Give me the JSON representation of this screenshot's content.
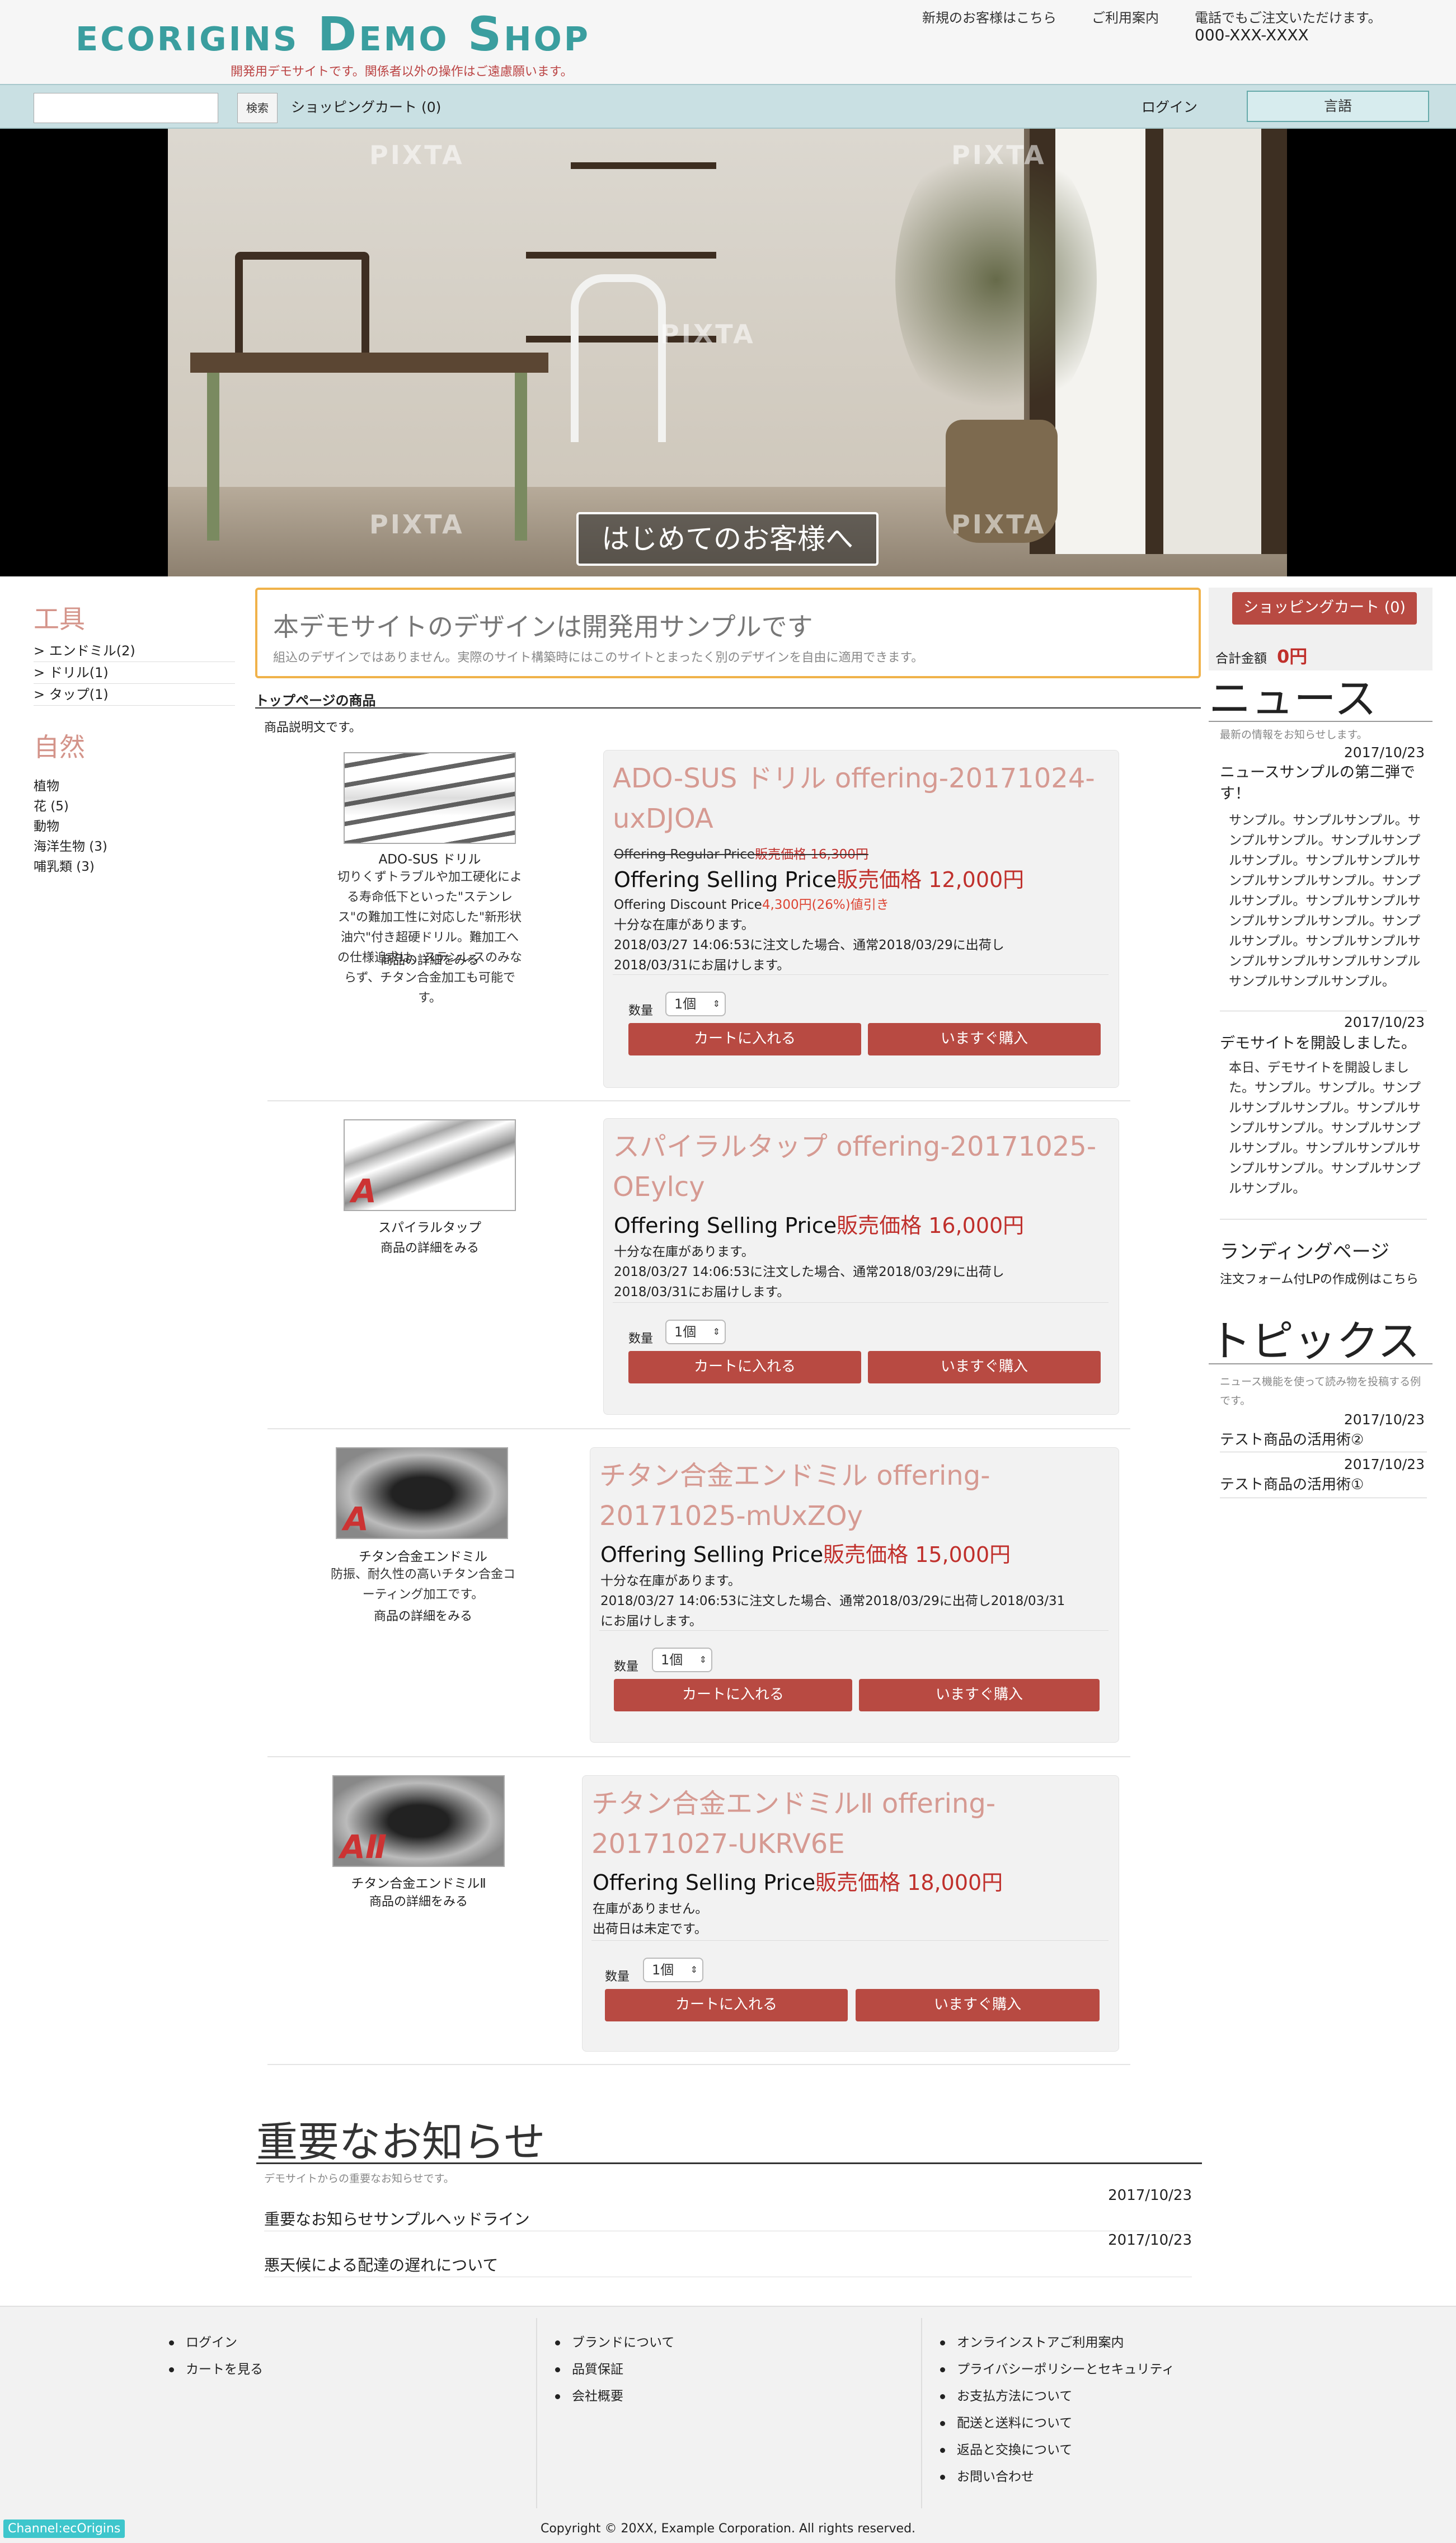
{
  "header": {
    "logo": "ecorigins Demo Shop",
    "tagline": "開発用デモサイトです。関係者以外の操作はご遠慮願います。",
    "links": [
      "新規のお客様はこちら",
      "ご利用案内",
      "電話でもご注文いただけます。"
    ],
    "phone": "000-XXX-XXXX"
  },
  "navbar": {
    "search_placeholder": "",
    "search_button": "検索",
    "cart": "ショッピングカート (0)",
    "login": "ログイン",
    "language": "言語"
  },
  "hero": {
    "watermark": "PIXTA",
    "cta": "はじめてのお客様へ"
  },
  "left_sidebar": {
    "tools_heading": "工具",
    "tools": [
      "> エンドミル(2)",
      "> ドリル(1)",
      "> タップ(1)"
    ],
    "nature_heading": "自然",
    "nature": [
      "植物",
      "花 (5)",
      "動物",
      "海洋生物 (3)",
      "哺乳類 (3)"
    ]
  },
  "notice": {
    "title": "本デモサイトのデザインは開発用サンプルです",
    "subtitle": "組込のデザインではありません。実際のサイト構築時にはこのサイトとまったく別のデザインを自由に適用できます。"
  },
  "section": {
    "title": "トップページの商品",
    "description": "商品説明文です。"
  },
  "common": {
    "detail_link": "商品の詳細をみる",
    "qty_label": "数量",
    "qty_value": "1個",
    "add_to_cart": "カートに入れる",
    "buy_now": "いますぐ購入",
    "selling_label": "Offering Selling Price",
    "sale_label": "販売価格"
  },
  "products": [
    {
      "thumb_name": "ADO-SUS ドリル",
      "thumb_desc": "切りくずトラブルや加工硬化による寿命低下といった\"ステンレス\"の難加工性に対応した\"新形状油穴\"付き超硬ドリル。難加工への仕様追求は、ステンレスのみならず、チタン合金加工も可能です。",
      "title": "ADO-SUS ドリル offering-20171024-uxDJOA",
      "regular_label": "Offering Regular Price",
      "regular_price": "販売価格 16,300円",
      "price": "12,000円",
      "discount_label": "Offering Discount Price",
      "discount_value": "4,300円(26%)値引き",
      "stock": "十分な在庫があります。",
      "ship1": "2018/03/27 14:06:53に注文した場合、通常2018/03/29に出荷し",
      "ship2": "2018/03/31にお届けします。"
    },
    {
      "thumb_name": "スパイラルタップ",
      "title": "スパイラルタップ offering-20171025-OEylcy",
      "price": "16,000円",
      "stock": "十分な在庫があります。",
      "ship1": "2018/03/27 14:06:53に注文した場合、通常2018/03/29に出荷し",
      "ship2": "2018/03/31にお届けします。"
    },
    {
      "thumb_name": "チタン合金エンドミル",
      "thumb_desc": "防振、耐久性の高いチタン合金コーティング加工です。",
      "title": "チタン合金エンドミル offering-20171025-mUxZOy",
      "price": "15,000円",
      "stock": "十分な在庫があります。",
      "ship1": "2018/03/27 14:06:53に注文した場合、通常2018/03/29に出荷し2018/03/31",
      "ship2": "にお届けします。"
    },
    {
      "thumb_name": "チタン合金エンドミルⅡ",
      "title": "チタン合金エンドミルⅡ offering-20171027-UKRV6E",
      "price": "18,000円",
      "stock": "在庫がありません。",
      "ship1": "出荷日は未定です。"
    }
  ],
  "right_sidebar": {
    "cart_button": "ショッピングカート (0)",
    "total_label": "合計金額",
    "total_value": "0円",
    "news_heading": "ニュース",
    "news_sub": "最新の情報をお知らせします。",
    "news": [
      {
        "date": "2017/10/23",
        "title": "ニュースサンプルの第二弾です！",
        "body": "サンプル。サンプルサンプル。サンプルサンプル。サンプルサンプルサンプル。サンプルサンプルサンプルサンプルサンプル。サンプルサンプル。サンプルサンプルサンプルサンプルサンプル。サンプルサンプル。サンプルサンプルサンプルサンプルサンプルサンプルサンプルサンプルサンプル。"
      },
      {
        "date": "2017/10/23",
        "title": "デモサイトを開設しました。",
        "body": "本日、デモサイトを開設しました。サンプル。サンプル。サンプルサンプルサンプル。サンプルサンプルサンプル。サンプルサンプルサンプル。サンプルサンプルサンプルサンプル。サンプルサンプルサンプル。"
      }
    ],
    "landing_title": "ランディングページ",
    "landing_body": "注文フォーム付LPの作成例はこちら",
    "topics_heading": "トピックス",
    "topics_sub": "ニュース機能を使って読み物を投稿する例です。",
    "topics": [
      {
        "date": "2017/10/23",
        "title": "テスト商品の活用術②"
      },
      {
        "date": "2017/10/23",
        "title": "テスト商品の活用術①"
      }
    ]
  },
  "important": {
    "title": "重要なお知らせ",
    "subtitle": "デモサイトからの重要なお知らせです。",
    "items": [
      {
        "date": "2017/10/23",
        "title": "重要なお知らせサンプルヘッドライン"
      },
      {
        "date": "2017/10/23",
        "title": "悪天候による配達の遅れについて"
      }
    ]
  },
  "footer": {
    "col1": [
      "ログイン",
      "カートを見る"
    ],
    "col2": [
      "ブランドについて",
      "品質保証",
      "会社概要"
    ],
    "col3": [
      "オンラインストアご利用案内",
      "プライバシーポリシーとセキュリティ",
      "お支払方法について",
      "配送と送料について",
      "返品と交換について",
      "お問い合わせ"
    ],
    "copyright": "Copyright © 20XX, Example Corporation. All rights reserved.",
    "channel": "Channel:ecOrigins"
  }
}
